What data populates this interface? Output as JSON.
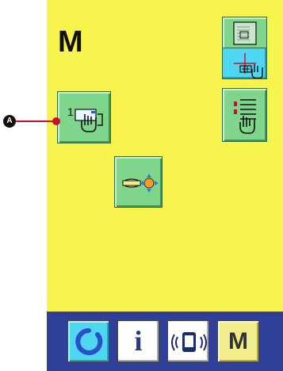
{
  "screen": {
    "title": "M",
    "marker_label": "A"
  },
  "buttons": {
    "bobbin_winder_counter": {
      "label": "1",
      "icon": "counter-setting-hand-icon"
    },
    "data_selection": {
      "icon": "pattern-data-hand-icon"
    },
    "list": {
      "icon": "list-hand-icon"
    },
    "feed_move": {
      "icon": "feed-move-cross-icon"
    }
  },
  "bottom_bar": {
    "reset_icon": "reset-ring-icon",
    "info_label": "i",
    "comm_icon": "communication-icon",
    "mode_label": "M"
  },
  "colors": {
    "screen_background": "#f7f34f",
    "button_green": "#7fd58c",
    "button_cyan": "#4fd6f0",
    "bottom_bar": "#2f3f9a",
    "marker_line": "#c8102e"
  }
}
